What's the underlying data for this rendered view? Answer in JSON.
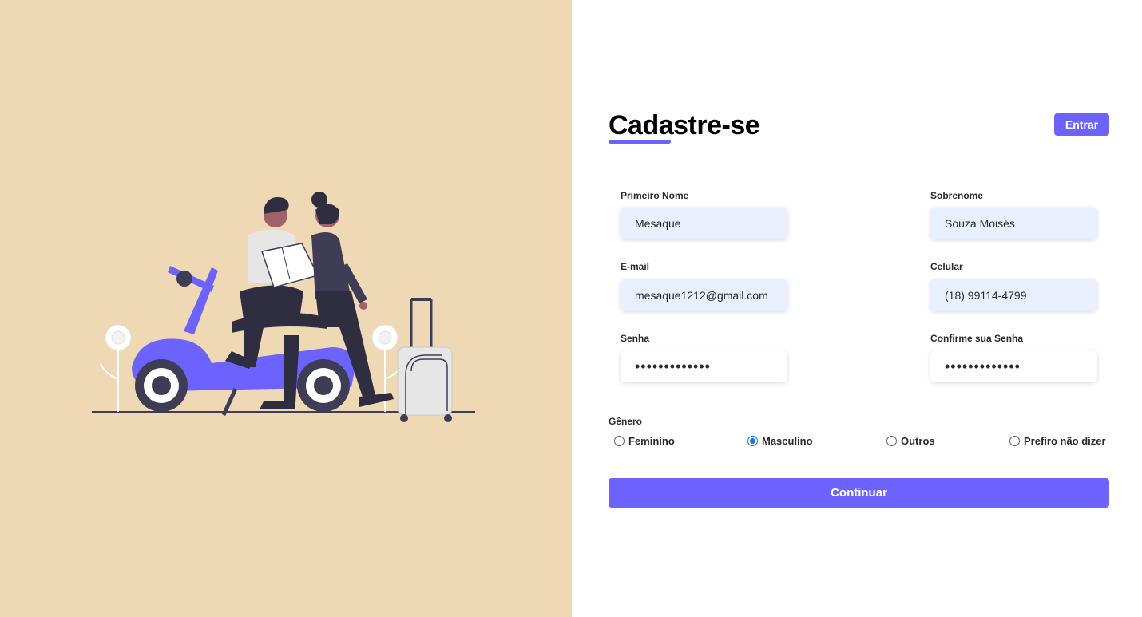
{
  "header": {
    "title": "Cadastre-se",
    "login_label": "Entrar"
  },
  "form": {
    "first_name": {
      "label": "Primeiro Nome",
      "value": "Mesaque"
    },
    "last_name": {
      "label": "Sobrenome",
      "value": "Souza Moisés"
    },
    "email": {
      "label": "E-mail",
      "value": "mesaque1212@gmail.com"
    },
    "phone": {
      "label": "Celular",
      "value": "(18) 99114-4799"
    },
    "password": {
      "label": "Senha",
      "value": "•••••••••••••"
    },
    "confirm_password": {
      "label": "Confirme sua Senha",
      "value": "•••••••••••••"
    }
  },
  "gender": {
    "label": "Gênero",
    "options": [
      {
        "label": "Feminino",
        "checked": false
      },
      {
        "label": "Masculino",
        "checked": true
      },
      {
        "label": "Outros",
        "checked": false
      },
      {
        "label": "Prefiro não dizer",
        "checked": false
      }
    ]
  },
  "submit": {
    "label": "Continuar"
  },
  "colors": {
    "accent": "#6c63ff",
    "left_panel_bg": "#efd9b4",
    "input_filled_bg": "#e8f0fe",
    "radio_checked": "#1a73e8"
  },
  "illustration": {
    "icon": "couple-on-scooter-illustration"
  }
}
